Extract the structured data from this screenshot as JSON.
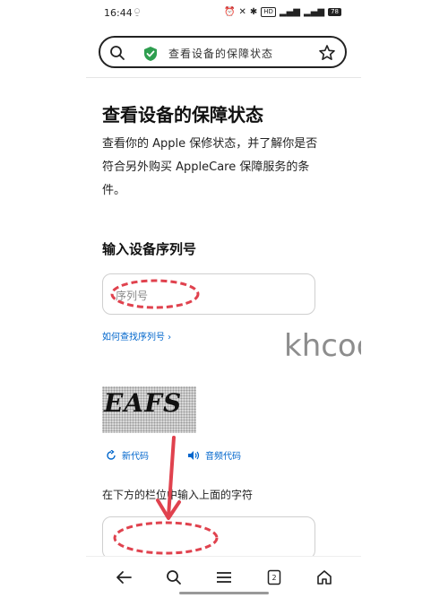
{
  "status_bar": {
    "time": "16:44",
    "battery": "78",
    "signal_badge": "HD"
  },
  "address_bar": {
    "text": "查看设备的保障状态",
    "search_icon": "search-icon",
    "secure_icon": "shield-check-icon",
    "bookmark_icon": "star-icon"
  },
  "main": {
    "title": "查看设备的保障状态",
    "intro": "查看你的 Apple 保修状态，并了解你是否符合另外购买 AppleCare 保障服务的条件。",
    "serial_heading": "输入设备序列号",
    "serial_placeholder": "序列号",
    "find_serial_link": "如何查找序列号 ›",
    "captcha_text": "EAFS",
    "new_code_label": "新代码",
    "audio_code_label": "音频代码",
    "captcha_instruction": "在下方的栏位中输入上面的字符",
    "captcha_input_value": ""
  },
  "watermark": "khcoo.com",
  "bottom_nav": {
    "tab_count": "2",
    "items": [
      "back-icon",
      "search-icon",
      "menu-icon",
      "tabs-icon",
      "home-icon"
    ]
  },
  "colors": {
    "accent": "#0066cc",
    "annotation": "#e0424e",
    "secure": "#2e9e4f"
  }
}
